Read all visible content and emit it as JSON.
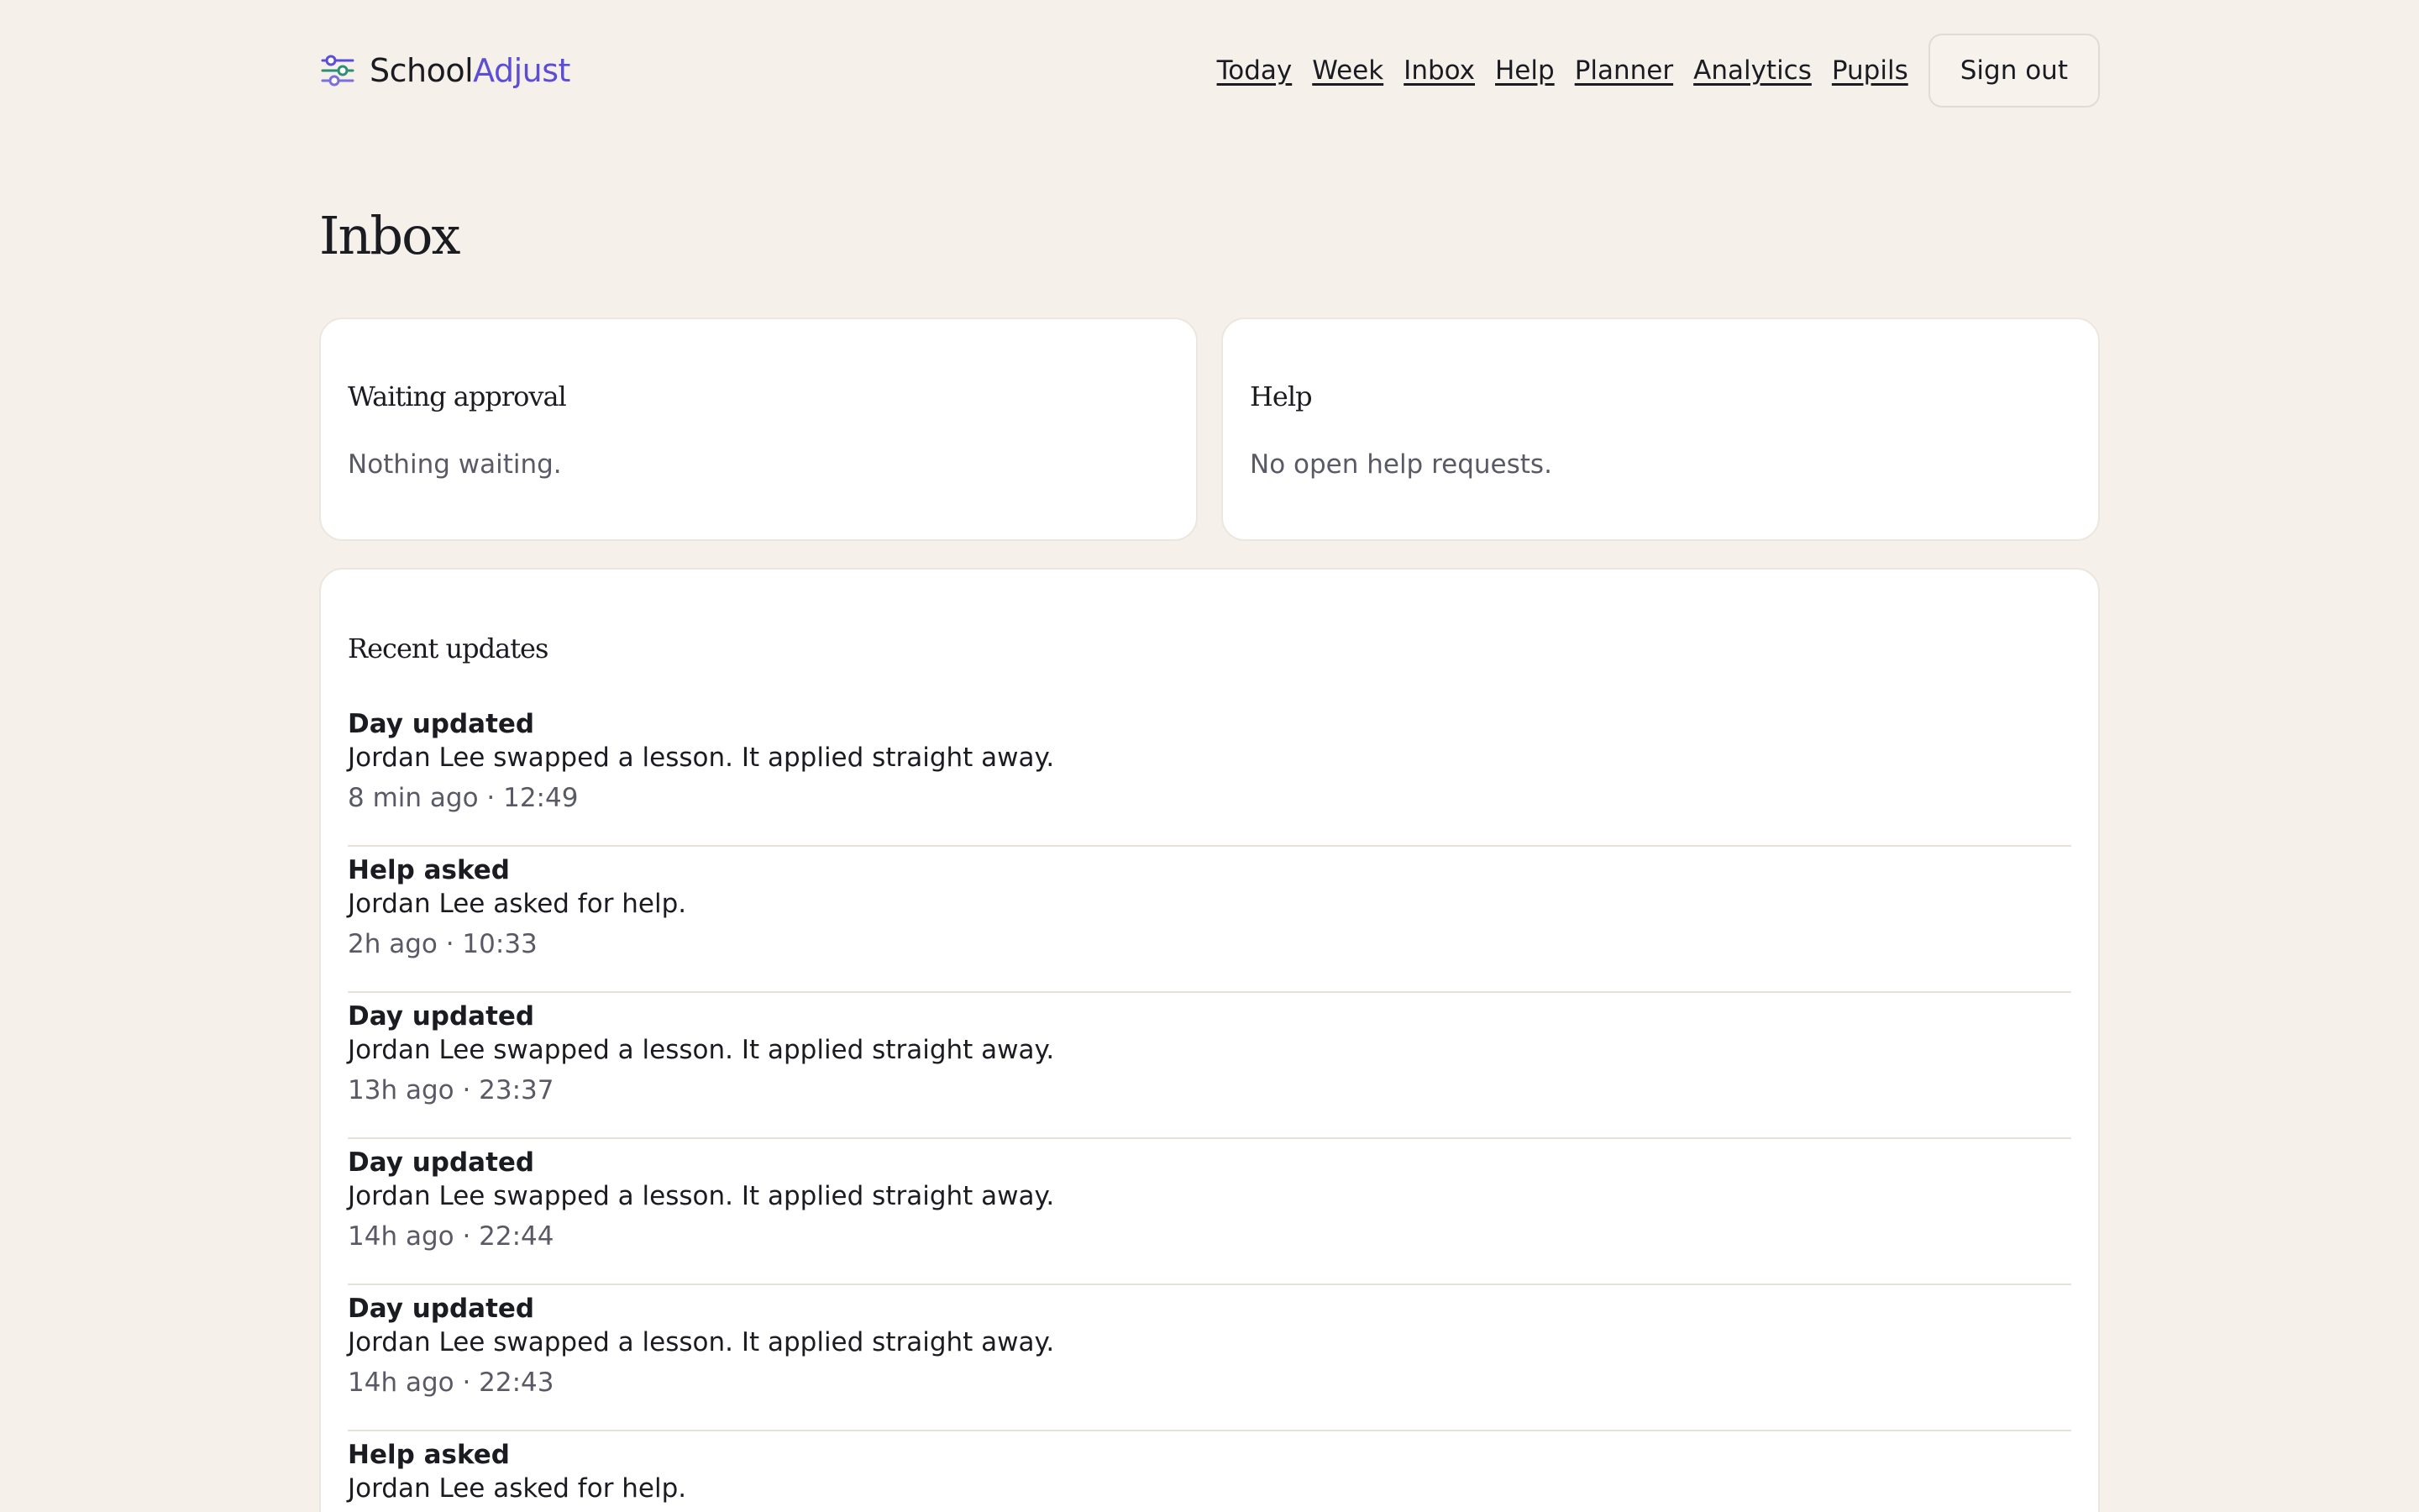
{
  "brand": {
    "name_part1": "School",
    "name_part2": "Adjust",
    "icon": "sliders-icon",
    "accent_color": "#5b4dd6"
  },
  "nav": {
    "items": [
      {
        "label": "Today"
      },
      {
        "label": "Week"
      },
      {
        "label": "Inbox"
      },
      {
        "label": "Help"
      },
      {
        "label": "Planner"
      },
      {
        "label": "Analytics"
      },
      {
        "label": "Pupils"
      }
    ],
    "signout_label": "Sign out"
  },
  "page": {
    "title": "Inbox"
  },
  "waiting": {
    "title": "Waiting approval",
    "empty": "Nothing waiting."
  },
  "help": {
    "title": "Help",
    "empty": "No open help requests."
  },
  "recent": {
    "title": "Recent updates",
    "items": [
      {
        "title": "Day updated",
        "desc": "Jordan Lee swapped a lesson. It applied straight away.",
        "meta": "8 min ago · 12:49"
      },
      {
        "title": "Help asked",
        "desc": "Jordan Lee asked for help.",
        "meta": "2h ago · 10:33"
      },
      {
        "title": "Day updated",
        "desc": "Jordan Lee swapped a lesson. It applied straight away.",
        "meta": "13h ago · 23:37"
      },
      {
        "title": "Day updated",
        "desc": "Jordan Lee swapped a lesson. It applied straight away.",
        "meta": "14h ago · 22:44"
      },
      {
        "title": "Day updated",
        "desc": "Jordan Lee swapped a lesson. It applied straight away.",
        "meta": "14h ago · 22:43"
      },
      {
        "title": "Help asked",
        "desc": "Jordan Lee asked for help.",
        "meta": ""
      }
    ]
  }
}
